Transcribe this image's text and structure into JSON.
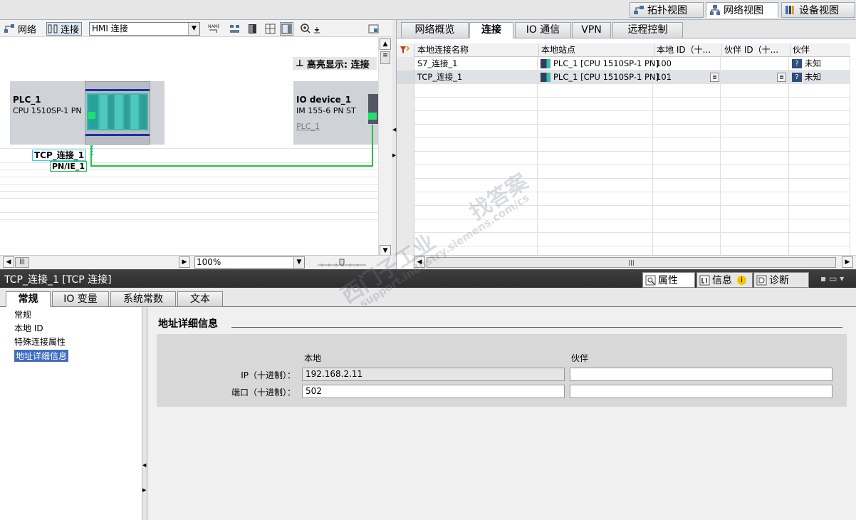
{
  "view_tabs": [
    {
      "label": "拓扑视图",
      "icon": "topology-view-icon"
    },
    {
      "label": "网络视图",
      "icon": "network-view-icon",
      "active": true
    },
    {
      "label": "设备视图",
      "icon": "device-view-icon"
    }
  ],
  "left_toolbar": {
    "network_label": "网络",
    "connection_label": "连接",
    "connection_type": "HMI 连接",
    "highlight_label": "高亮显示: 连接"
  },
  "devices": [
    {
      "name": "PLC_1",
      "type": "CPU 1510SP-1 PN"
    },
    {
      "name": "IO device_1",
      "type": "IM 155-6 PN ST",
      "controller": "PLC_1"
    }
  ],
  "network": {
    "connection_label": "TCP_连接_1",
    "subnet_label": "PN/IE_1"
  },
  "zoom": {
    "value": "100%"
  },
  "right_tabs": [
    {
      "label": "网络概览"
    },
    {
      "label": "连接",
      "active": true
    },
    {
      "label": "IO 通信"
    },
    {
      "label": "VPN"
    },
    {
      "label": "远程控制"
    }
  ],
  "connections_table": {
    "columns": [
      "本地连接名称",
      "本地站点",
      "本地 ID（十...",
      "伙伴 ID（十...",
      "伙伴"
    ],
    "rows": [
      {
        "name": "S7_连接_1",
        "station": "PLC_1 [CPU 1510SP-1 PN]",
        "local_id": "100",
        "partner_id": "",
        "partner": "未知"
      },
      {
        "name": "TCP_连接_1",
        "station": "PLC_1 [CPU 1510SP-1 PN]",
        "local_id": "101",
        "partner_id": "",
        "partner": "未知"
      }
    ]
  },
  "inspector": {
    "title": "TCP_连接_1 [TCP 连接]",
    "tabs": [
      {
        "label": "属性",
        "icon": "properties-icon",
        "active": true
      },
      {
        "label": "信息",
        "icon": "info-icon"
      },
      {
        "label": "诊断",
        "icon": "diagnostics-icon"
      }
    ],
    "sub_tabs": [
      {
        "label": "常规",
        "active": true
      },
      {
        "label": "IO 变量"
      },
      {
        "label": "系统常数"
      },
      {
        "label": "文本"
      }
    ],
    "nav": [
      {
        "label": "常规"
      },
      {
        "label": "本地 ID"
      },
      {
        "label": "特殊连接属性"
      },
      {
        "label": "地址详细信息",
        "selected": true
      }
    ],
    "section_title": "地址详细信息",
    "col_local": "本地",
    "col_partner": "伙伴",
    "ip_label": "IP（十进制）：",
    "port_label": "端口（十进制）：",
    "local_ip": "192.168.2.11",
    "partner_ip": "",
    "local_port": "502",
    "partner_port": ""
  },
  "watermark": {
    "line1": "西门子工业",
    "line2": "support.industry.siemens.com/cs",
    "line3": "找答案"
  },
  "colors": {
    "network_line": "#1fc24a",
    "connection_line": "#33c9e6",
    "selection": "#3a6bc7",
    "title_bar": "#363636"
  }
}
